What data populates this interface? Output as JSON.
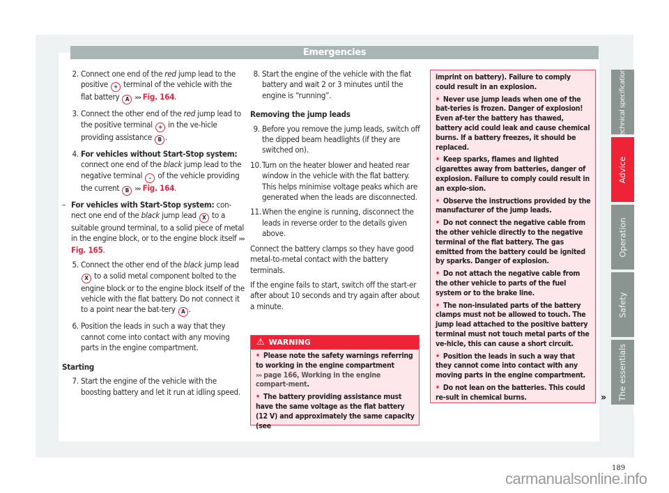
{
  "header": {
    "title": "Emergencies"
  },
  "column1": {
    "step2": {
      "num": "2.",
      "t1": "Connect one end of the ",
      "t1i": "red",
      "t2": " jump lead to the positive ",
      "sym1": "+",
      "t3": " terminal of the vehicle with the flat battery ",
      "sym2": "A",
      "arrows": "›››",
      "ref": "Fig. 164",
      "end": "."
    },
    "step3": {
      "num": "3.",
      "t1": "Connect the other end of the ",
      "t1i": "red",
      "t2": " jump lead to the positive terminal ",
      "sym1": "+",
      "t3": " in the ve-hicle providing assistance ",
      "sym2": "B",
      "end": "."
    },
    "step4": {
      "num": "4.",
      "bold": "For vehicles without Start-Stop system:",
      "t1": " connect one end of the ",
      "t1i": "black",
      "t2": " jump lead to the negative terminal ",
      "sym1": "–",
      "t3": " of the vehicle providing the current ",
      "sym2": "B",
      "arrows": "›››",
      "ref": "Fig. 164",
      "end": "."
    },
    "stepdash": {
      "num": "–",
      "bold": "For vehicles with Start-Stop system:",
      "t1": " con-nect one end of the ",
      "t1i": "black",
      "t2": " jump lead ",
      "sym1": "X",
      "t3": " to a suitable ground terminal, to a solid piece of metal in the engine block, or to the engine block itself ",
      "arrows": "›››",
      "ref": "Fig. 165",
      "end": "."
    },
    "step5": {
      "num": "5.",
      "t1": "Connect the other end of the ",
      "t1i": "black",
      "t2": " jump lead ",
      "sym1": "X",
      "t3": " to a solid metal component bolted to the engine block or to the engine block itself of the vehicle with the flat battery. Do not connect it to a point near the bat-tery ",
      "sym2": "A",
      "end": "."
    },
    "step6": {
      "num": "6.",
      "text": "Position the leads in such a way that they cannot come into contact with any moving parts in the engine compartment."
    },
    "starting_heading": "Starting",
    "step7": {
      "num": "7.",
      "text": "Start the engine of the vehicle with the boosting battery and let it run at idling speed."
    }
  },
  "column2": {
    "step8": {
      "num": "8.",
      "text": "Start the engine of the vehicle with the flat battery and wait 2 or 3 minutes until the engine is “running”."
    },
    "removing_heading": "Removing the jump leads",
    "step9": {
      "num": "9.",
      "text": "Before you remove the jump leads, switch off the dipped beam headlights (if they are switched on)."
    },
    "step10": {
      "num": "10.",
      "text": "Turn on the heater blower and heated rear window in the vehicle with the flat battery. This helps minimise voltage peaks which are generated when the leads are disconnected."
    },
    "step11": {
      "num": "11.",
      "text": "When the engine is running, disconnect the leads in reverse order to the details given above."
    },
    "para1": "Connect the battery clamps so they have good metal-to-metal contact with the battery terminals.",
    "para2": "If the engine fails to start, switch off the start-er after about 10 seconds and try again after about a minute."
  },
  "warning": {
    "label": "WARNING",
    "icon": "warning-triangle-icon",
    "b1_text": "Please note the safety warnings referring to working in the engine compartment",
    "b1_link_arrows": "›››",
    "b1_link": "page 166, Working in the engine compart-ment",
    "b1_end": ".",
    "b2": "The battery providing assistance must have the same voltage as the flat battery (12 V) and approximately the same capacity (see",
    "cont": "imprint on battery). Failure to comply could result in an explosion.",
    "b3": "Never use jump leads when one of the bat-teries is frozen. Danger of explosion! Even af-ter the battery has thawed, battery acid could leak and cause chemical burns. If a battery freezes, it should be replaced.",
    "b4": "Keep sparks, flames and lighted cigarettes away from batteries, danger of explosion. Failure to comply could result in an explo-sion.",
    "b5": "Observe the instructions provided by the manufacturer of the jump leads.",
    "b6": "Do not connect the negative cable from the other vehicle directly to the negative terminal of the flat battery. The gas emitted from the battery could be ignited by sparks. Danger of explosion.",
    "b7": "Do not attach the negative cable from the other vehicle to parts of the fuel system or to the brake line.",
    "b8": "The non-insulated parts of the battery clamps must not be allowed to touch. The jump lead attached to the positive battery terminal must not touch metal parts of the ve-hicle, this can cause a short circuit.",
    "b9": "Position the leads in such a way that they cannot come into contact with any moving parts in the engine compartment.",
    "b10": "Do not lean on the batteries. This could re-sult in chemical burns.",
    "bullet": "•",
    "continue_marker": "»"
  },
  "side_tabs": [
    {
      "label": "Technical specifications",
      "active": false
    },
    {
      "label": "Advice",
      "active": true
    },
    {
      "label": "Operation",
      "active": false
    },
    {
      "label": "Safety",
      "active": false
    },
    {
      "label": "The essentials",
      "active": false
    }
  ],
  "page_number": "189",
  "watermark": "carmanualsonline.info",
  "colors": {
    "accent": "#ee2336",
    "header_bar": "#a8b5b3",
    "tab_gray": "#8a9490",
    "warning_bg": "#fde7eb"
  }
}
